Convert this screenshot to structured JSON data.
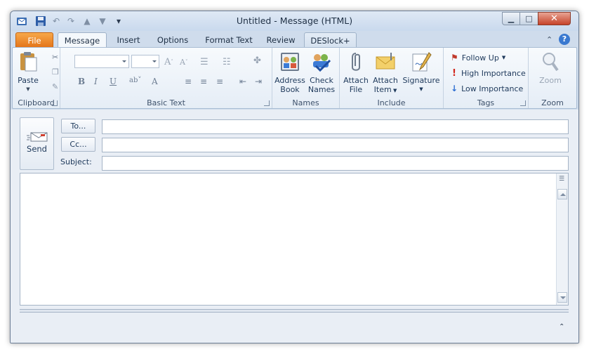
{
  "window": {
    "title": "Untitled  -  Message (HTML)",
    "qat_icons": [
      "outlook-icon",
      "save-icon",
      "undo-icon",
      "redo-icon",
      "up-arrow-icon",
      "down-arrow-icon",
      "customize-qat-icon"
    ],
    "controls": [
      "minimize",
      "maximize",
      "close"
    ]
  },
  "tabs": [
    {
      "label": "File",
      "active": false
    },
    {
      "label": "Message",
      "active": true
    },
    {
      "label": "Insert",
      "active": false
    },
    {
      "label": "Options",
      "active": false
    },
    {
      "label": "Format Text",
      "active": false
    },
    {
      "label": "Review",
      "active": false
    },
    {
      "label": "DESlock+",
      "active": false
    }
  ],
  "ribbon": {
    "clipboard": {
      "label": "Clipboard",
      "paste": "Paste"
    },
    "basic_text": {
      "label": "Basic Text",
      "font_name": "",
      "font_size": ""
    },
    "names": {
      "label": "Names",
      "address_book_1": "Address",
      "address_book_2": "Book",
      "check_names_1": "Check",
      "check_names_2": "Names"
    },
    "include": {
      "label": "Include",
      "attach_file_1": "Attach",
      "attach_file_2": "File",
      "attach_item_1": "Attach",
      "attach_item_2": "Item",
      "signature": "Signature"
    },
    "tags": {
      "label": "Tags",
      "follow_up": "Follow Up",
      "high_importance": "High Importance",
      "low_importance": "Low Importance"
    },
    "zoom": {
      "label": "Zoom",
      "zoom": "Zoom"
    }
  },
  "compose": {
    "send": "Send",
    "to_button": "To...",
    "cc_button": "Cc...",
    "subject_label": "Subject:",
    "to_value": "",
    "cc_value": "",
    "subject_value": "",
    "body_text": ""
  },
  "colors": {
    "file_tab": "#e4751a",
    "ribbon_bg": "#e5edf6",
    "frame": "#cfdcec",
    "close_button": "#c6432a"
  }
}
